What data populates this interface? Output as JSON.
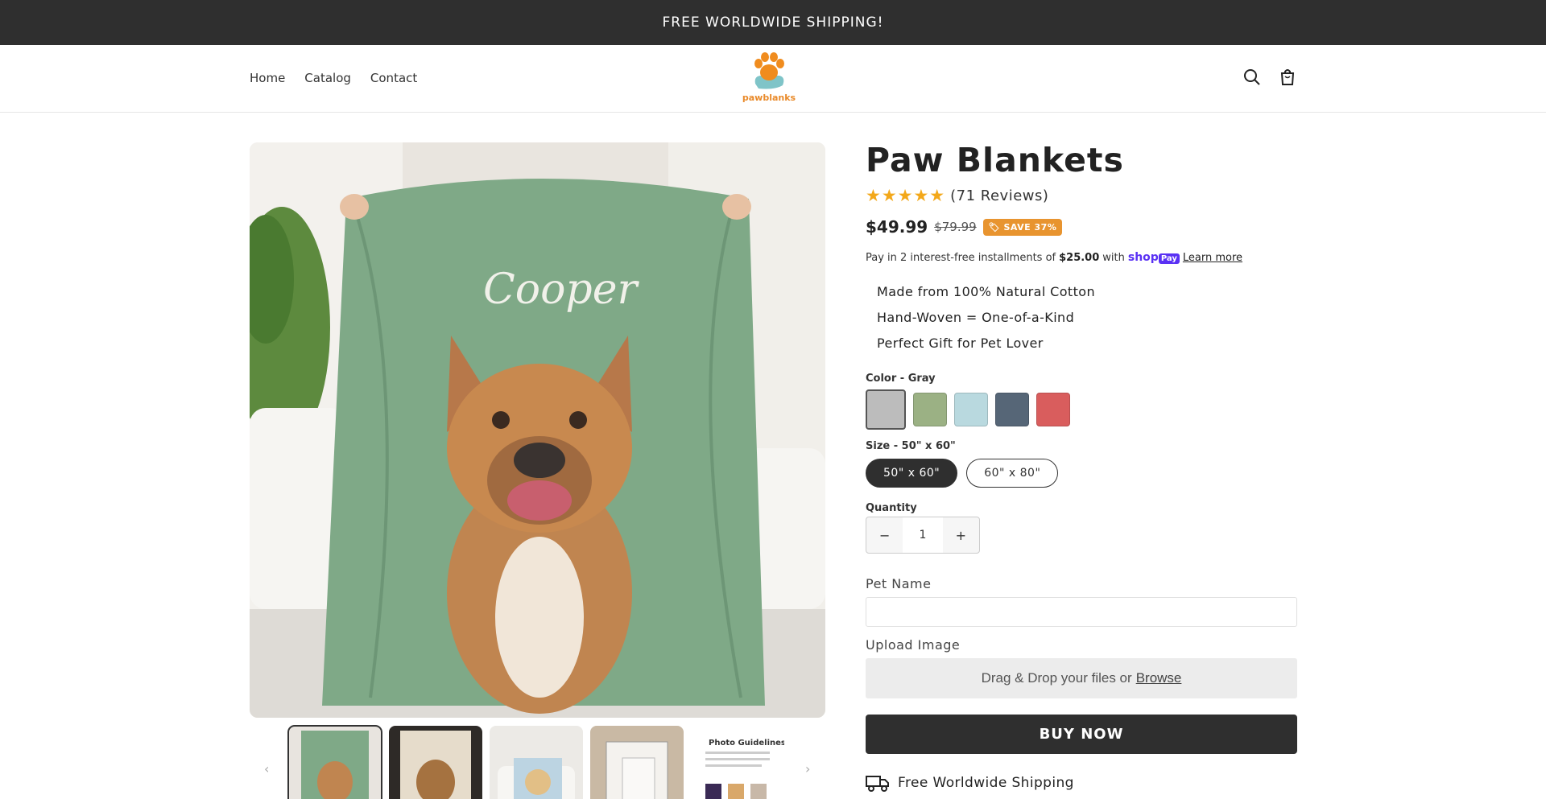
{
  "announcement": "FREE WORLDWIDE SHIPPING!",
  "nav": [
    "Home",
    "Catalog",
    "Contact"
  ],
  "logo_text": "pawblanks",
  "product": {
    "title": "Paw Blankets",
    "stars": "★★★★★",
    "reviews": "(71 Reviews)",
    "price": "$49.99",
    "compare_price": "$79.99",
    "save_badge": "SAVE 37%",
    "installments": {
      "prefix": "Pay in 2 interest-free installments of",
      "amount": "$25.00",
      "with": "with",
      "brand": "shop",
      "brand_pay": "Pay",
      "learn_more": "Learn more"
    },
    "features": [
      "Made from 100% Natural Cotton",
      "Hand-Woven = One-of-a-Kind",
      "Perfect Gift for Pet Lover"
    ],
    "color_label": "Color - Gray",
    "colors": [
      {
        "name": "Gray",
        "hex": "#bcbcbc"
      },
      {
        "name": "Sage",
        "hex": "#9bb184"
      },
      {
        "name": "Light Blue",
        "hex": "#b9d9df"
      },
      {
        "name": "Slate",
        "hex": "#566677"
      },
      {
        "name": "Red",
        "hex": "#d95d5d"
      }
    ],
    "size_label": "Size - 50\" x 60\"",
    "sizes": [
      "50\" x 60\"",
      "60\" x 80\""
    ],
    "quantity_label": "Quantity",
    "quantity": "1",
    "minus": "−",
    "plus": "+",
    "pet_name_label": "Pet Name",
    "upload_label": "Upload Image",
    "upload_text": "Drag & Drop your files or",
    "upload_browse": "Browse",
    "buy_now": "BUY NOW",
    "shipping": "Free Worldwide Shipping",
    "main_image_name": "Cooper",
    "thumb_guidelines_title": "Photo Guidelines"
  },
  "colors": {
    "dark": "#2f2f2f",
    "accent": "#e8942f",
    "blanket": "#7fa987"
  }
}
